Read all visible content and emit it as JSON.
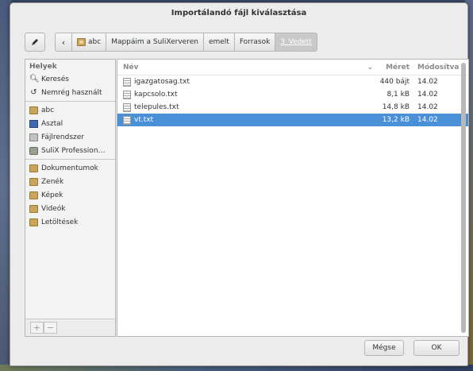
{
  "dialog": {
    "title": "Importálandó fájl kiválasztása"
  },
  "toolbar": {
    "edit_icon": "pencil-icon",
    "back_label": "‹",
    "crumbs": [
      "abc",
      "Mappáim a SuliXerveren",
      "emelt",
      "Forrasok",
      "3_Vedett"
    ]
  },
  "sidebar": {
    "header": "Helyek",
    "items": [
      {
        "label": "Keresés",
        "icon": "search-icon"
      },
      {
        "label": "Nemrég használt",
        "icon": "recent-icon"
      },
      {
        "label": "abc",
        "icon": "folder-icon"
      },
      {
        "label": "Asztal",
        "icon": "desktop-icon"
      },
      {
        "label": "Fájlrendszer",
        "icon": "drive-icon"
      },
      {
        "label": "SuliX Profession…",
        "icon": "disk-icon"
      },
      {
        "label": "Dokumentumok",
        "icon": "folder-icon"
      },
      {
        "label": "Zenék",
        "icon": "folder-icon"
      },
      {
        "label": "Képek",
        "icon": "folder-icon"
      },
      {
        "label": "Videók",
        "icon": "folder-icon"
      },
      {
        "label": "Letöltések",
        "icon": "folder-icon"
      }
    ],
    "add_label": "+",
    "remove_label": "−"
  },
  "files": {
    "columns": {
      "name": "Név",
      "size": "Méret",
      "modified": "Módosítva"
    },
    "sort_indicator": "⌄",
    "rows": [
      {
        "name": "igazgatosag.txt",
        "size": "440 bájt",
        "modified": "14.02"
      },
      {
        "name": "kapcsolo.txt",
        "size": "8,1 kB",
        "modified": "14.02"
      },
      {
        "name": "telepules.txt",
        "size": "14,8 kB",
        "modified": "14.02"
      },
      {
        "name": "vt.txt",
        "size": "13,2 kB",
        "modified": "14.02"
      }
    ]
  },
  "buttons": {
    "cancel": "Mégse",
    "ok": "OK"
  },
  "colors": {
    "selection": "#4a90d9",
    "folder": "#c8a55b"
  }
}
